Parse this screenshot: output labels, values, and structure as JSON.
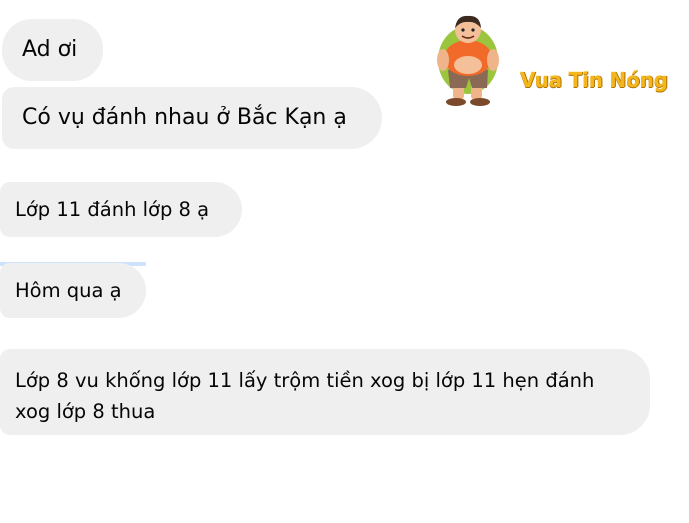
{
  "messages": [
    {
      "text": "Ad ơi"
    },
    {
      "text": "Có vụ đánh nhau ở Bắc Kạn ạ"
    },
    {
      "text": "Lớp 11 đánh lớp 8 ạ"
    },
    {
      "text": "Hôm qua ạ"
    },
    {
      "text": "Lớp 8 vu khống lớp 11 lấy trộm tiền xog bị lớp 11 hẹn đánh xog lớp 8 thua"
    }
  ],
  "watermark": {
    "text": "Vua Tin Nóng",
    "color": "#f4b51d",
    "icon": "mascot-icon"
  },
  "colors": {
    "bubble_bg": "#efeff0",
    "text": "#050505",
    "accent": "#cfe2fb"
  }
}
